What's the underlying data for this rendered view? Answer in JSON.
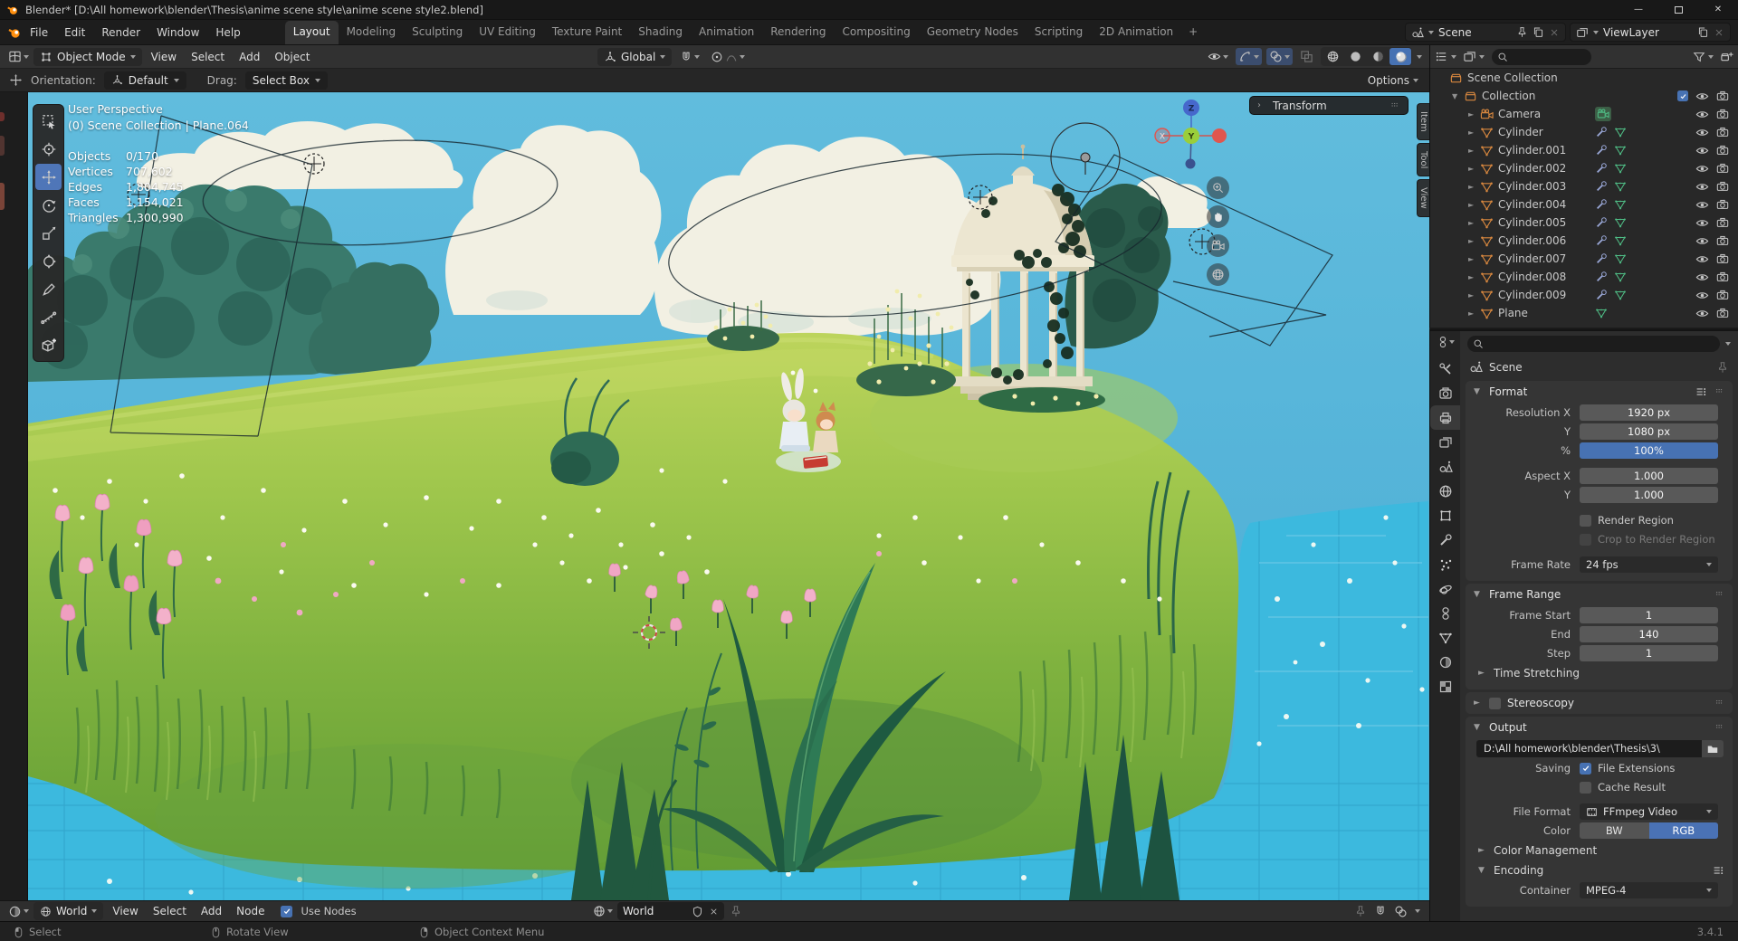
{
  "window": {
    "title": "Blender* [D:\\All homework\\blender\\Thesis\\anime scene style\\anime scene style2.blend]",
    "minimize": "—",
    "close": "✕"
  },
  "topbar": {
    "menus": [
      {
        "label": "File"
      },
      {
        "label": "Edit"
      },
      {
        "label": "Render"
      },
      {
        "label": "Window"
      },
      {
        "label": "Help"
      }
    ],
    "workspaces": [
      {
        "label": "Layout",
        "state": "active"
      },
      {
        "label": "Modeling"
      },
      {
        "label": "Sculpting"
      },
      {
        "label": "UV Editing"
      },
      {
        "label": "Texture Paint"
      },
      {
        "label": "Shading"
      },
      {
        "label": "Animation"
      },
      {
        "label": "Rendering"
      },
      {
        "label": "Compositing"
      },
      {
        "label": "Geometry Nodes"
      },
      {
        "label": "Scripting"
      },
      {
        "label": "2D Animation"
      }
    ],
    "add_workspace": "+",
    "scene_selector": {
      "value": "Scene"
    },
    "view_layer_selector": {
      "value": "ViewLayer"
    }
  },
  "viewport_header": {
    "mode": "Object Mode",
    "menus": [
      {
        "label": "View"
      },
      {
        "label": "Select"
      },
      {
        "label": "Add"
      },
      {
        "label": "Object"
      }
    ],
    "orientation": "Global"
  },
  "tool_settings": {
    "orientation_label": "Orientation:",
    "orientation_value": "Default",
    "drag_label": "Drag:",
    "drag_value": "Select Box",
    "options_label": "Options"
  },
  "toolbar": {
    "tools": [
      {
        "name": "tweak-select",
        "icon": "tb-select"
      },
      {
        "name": "cursor",
        "icon": "tb-cursor"
      },
      {
        "name": "move",
        "icon": "tb-move",
        "state": "active"
      },
      {
        "name": "rotate",
        "icon": "tb-rotate"
      },
      {
        "name": "scale",
        "icon": "tb-scale"
      },
      {
        "name": "transform",
        "icon": "tb-transform"
      },
      {
        "name": "annotate",
        "icon": "tb-annotate"
      },
      {
        "name": "measure",
        "icon": "tb-measure"
      },
      {
        "name": "add-cube",
        "icon": "tb-addcube"
      }
    ]
  },
  "viewport": {
    "overlay": {
      "view_name": "User Perspective",
      "context_path": "(0) Scene Collection | Plane.064",
      "stats": [
        {
          "label": "Objects",
          "value": "0/170"
        },
        {
          "label": "Vertices",
          "value": "707,602"
        },
        {
          "label": "Edges",
          "value": "1,804,745"
        },
        {
          "label": "Faces",
          "value": "1,154,021"
        },
        {
          "label": "Triangles",
          "value": "1,300,990"
        }
      ]
    },
    "transform_panel_label": "Transform",
    "sidebar_tabs": [
      {
        "label": "Item"
      },
      {
        "label": "Tool"
      },
      {
        "label": "View"
      }
    ],
    "gizmo": {
      "x": "X",
      "y": "Y",
      "z": "Z"
    }
  },
  "outliner": {
    "items": [
      {
        "label": "Scene Collection",
        "icon": "ic-collection",
        "ind": "i0",
        "disc": "none"
      },
      {
        "label": "Collection",
        "icon": "ic-collection",
        "ind": "i1",
        "disc": "open",
        "check": true,
        "eye": true,
        "cam": true
      },
      {
        "label": "Camera",
        "icon": "ic-videocam",
        "ind": "i2",
        "disc": "closed",
        "camdata": true,
        "eye": true,
        "cam": true
      },
      {
        "label": "Cylinder",
        "icon": "ic-meshobj",
        "ind": "i2",
        "disc": "closed",
        "wrench": true,
        "meshdata": true,
        "eye": true,
        "cam": true
      },
      {
        "label": "Cylinder.001",
        "icon": "ic-meshobj",
        "ind": "i2",
        "disc": "closed",
        "wrench": true,
        "meshdata": true,
        "eye": true,
        "cam": true
      },
      {
        "label": "Cylinder.002",
        "icon": "ic-meshobj",
        "ind": "i2",
        "disc": "closed",
        "wrench": true,
        "meshdata": true,
        "eye": true,
        "cam": true
      },
      {
        "label": "Cylinder.003",
        "icon": "ic-meshobj",
        "ind": "i2",
        "disc": "closed",
        "wrench": true,
        "meshdata": true,
        "eye": true,
        "cam": true
      },
      {
        "label": "Cylinder.004",
        "icon": "ic-meshobj",
        "ind": "i2",
        "disc": "closed",
        "wrench": true,
        "meshdata": true,
        "eye": true,
        "cam": true
      },
      {
        "label": "Cylinder.005",
        "icon": "ic-meshobj",
        "ind": "i2",
        "disc": "closed",
        "wrench": true,
        "meshdata": true,
        "eye": true,
        "cam": true
      },
      {
        "label": "Cylinder.006",
        "icon": "ic-meshobj",
        "ind": "i2",
        "disc": "closed",
        "wrench": true,
        "meshdata": true,
        "eye": true,
        "cam": true
      },
      {
        "label": "Cylinder.007",
        "icon": "ic-meshobj",
        "ind": "i2",
        "disc": "closed",
        "wrench": true,
        "meshdata": true,
        "eye": true,
        "cam": true
      },
      {
        "label": "Cylinder.008",
        "icon": "ic-meshobj",
        "ind": "i2",
        "disc": "closed",
        "wrench": true,
        "meshdata": true,
        "eye": true,
        "cam": true
      },
      {
        "label": "Cylinder.009",
        "icon": "ic-meshobj",
        "ind": "i2",
        "disc": "closed",
        "wrench": true,
        "meshdata": true,
        "eye": true,
        "cam": true
      },
      {
        "label": "Plane",
        "icon": "ic-meshobj",
        "ind": "i2",
        "disc": "closed",
        "meshdata": true,
        "eye": true,
        "cam": true
      }
    ]
  },
  "properties": {
    "breadcrumb": "Scene",
    "tabs": [
      {
        "name": "tool",
        "icon": "ic-tool"
      },
      {
        "name": "render",
        "icon": "ic-render"
      },
      {
        "name": "output",
        "icon": "ic-output",
        "state": "active"
      },
      {
        "name": "view-layer",
        "icon": "ic-viewlayer"
      },
      {
        "name": "scene",
        "icon": "ic-scene"
      },
      {
        "name": "world",
        "icon": "ic-world"
      },
      {
        "name": "object",
        "icon": "ic-object"
      },
      {
        "name": "modifiers",
        "icon": "ic-wrench"
      },
      {
        "name": "particles",
        "icon": "ic-particles"
      },
      {
        "name": "physics",
        "icon": "ic-physics"
      },
      {
        "name": "constraints",
        "icon": "ic-constraints"
      },
      {
        "name": "object-data",
        "icon": "ic-meshdata"
      },
      {
        "name": "material",
        "icon": "ic-material"
      },
      {
        "name": "texture",
        "icon": "ic-texture"
      }
    ],
    "format": {
      "title": "Format",
      "resolution_x_label": "Resolution X",
      "resolution_x": "1920 px",
      "resolution_y_label": "Y",
      "resolution_y": "1080 px",
      "scale_label": "%",
      "scale": "100%",
      "aspect_x_label": "Aspect X",
      "aspect_x": "1.000",
      "aspect_y_label": "Y",
      "aspect_y": "1.000",
      "render_region": "Render Region",
      "crop_to_render_region": "Crop to Render Region",
      "frame_rate_label": "Frame Rate",
      "frame_rate": "24 fps"
    },
    "frame_range": {
      "title": "Frame Range",
      "start_label": "Frame Start",
      "start": "1",
      "end_label": "End",
      "end": "140",
      "step_label": "Step",
      "step": "1",
      "time_stretching": "Time Stretching"
    },
    "stereoscopy": {
      "title": "Stereoscopy"
    },
    "output": {
      "title": "Output",
      "path": "D:\\All homework\\blender\\Thesis\\3\\",
      "saving_label": "Saving",
      "file_extensions": "File Extensions",
      "cache_result": "Cache Result",
      "file_format_label": "File Format",
      "file_format": "FFmpeg Video",
      "color_label": "Color",
      "bw": "BW",
      "rgb": "RGB",
      "color_management": "Color Management",
      "encoding": "Encoding",
      "container_label": "Container",
      "container": "MPEG-4"
    }
  },
  "shader_editor": {
    "type_value": "World",
    "menus": [
      {
        "label": "View"
      },
      {
        "label": "Select"
      },
      {
        "label": "Add"
      },
      {
        "label": "Node"
      }
    ],
    "use_nodes_label": "Use Nodes",
    "datablock_name": "World"
  },
  "status_bar": {
    "hints": [
      {
        "label": "Select",
        "btn": "mouse-left"
      },
      {
        "label": "Rotate View",
        "btn": "mouse-middle"
      },
      {
        "label": "Object Context Menu",
        "btn": "mouse-right"
      }
    ],
    "version": "3.4.1"
  },
  "colors": {
    "accent": "#4772b3",
    "active_tool": "#4f76b8",
    "axis_x": "#e0564f",
    "axis_y": "#9ace3a",
    "axis_z": "#4668cc",
    "sky": "#4fb0d8",
    "grass": "#8fbf49",
    "water": "#3cb9de"
  }
}
